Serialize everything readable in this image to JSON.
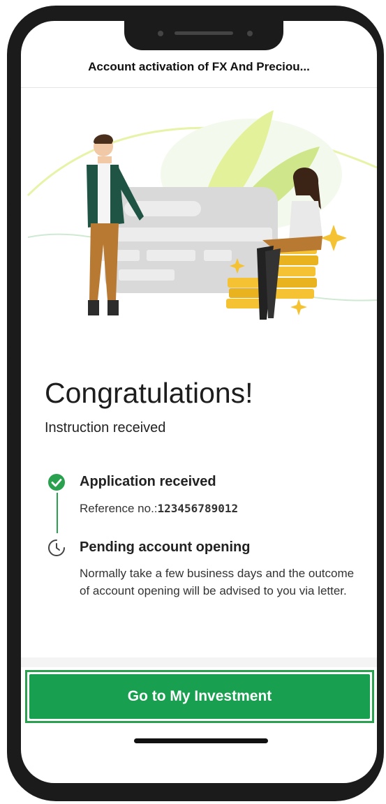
{
  "header": {
    "title": "Account activation of FX And Preciou..."
  },
  "result": {
    "heading": "Congratulations!",
    "subheading": "Instruction received"
  },
  "steps": [
    {
      "status": "completed",
      "icon": "check-circle-icon",
      "title": "Application received",
      "reference_label": "Reference no.:",
      "reference_number": "123456789012"
    },
    {
      "status": "pending",
      "icon": "clock-icon",
      "title": "Pending account opening",
      "description": "Normally take a few business days and the outcome of account opening will be advised to you via letter."
    }
  ],
  "actions": {
    "primary_label": "Go to My Investment"
  },
  "colors": {
    "accent": "#18a050",
    "check": "#2aa14f",
    "coin": "#f4c232",
    "leaf": "#dff08a"
  }
}
